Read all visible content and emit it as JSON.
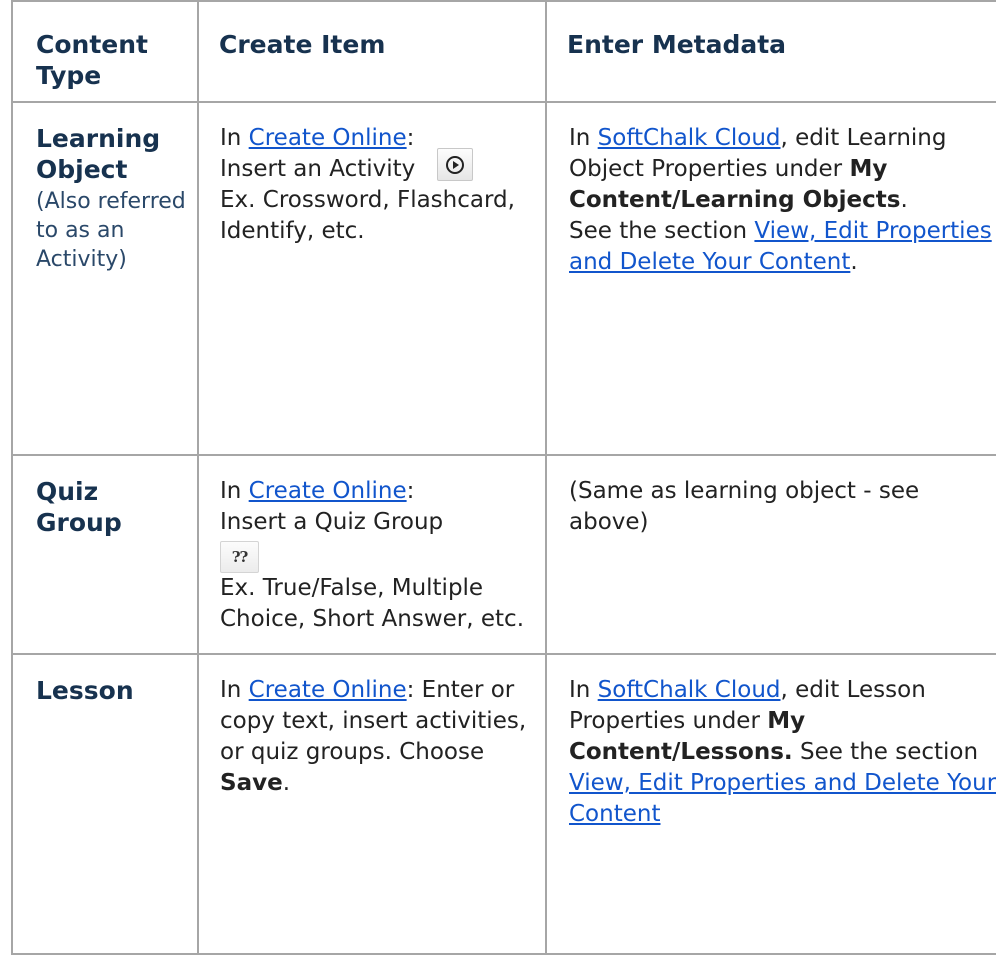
{
  "table": {
    "headers": {
      "col1": "Content Type",
      "col2": "Create Item",
      "col3": "Enter Metadata"
    },
    "rows": {
      "learning_object": {
        "type": "Learning Object",
        "note": "(Also referred to as an Activity)",
        "create": {
          "intro_prefix": "In ",
          "intro_link": "Create Online",
          "intro_suffix": ":",
          "step": "Insert an Activity",
          "icon": "play-circle-icon",
          "example": "Ex. Crossword, Flashcard, Identify, etc."
        },
        "metadata": {
          "p1_prefix": "In ",
          "p1_link": "SoftChalk Cloud",
          "p1_mid": ", edit Learning Object Properties under ",
          "p1_bold": "My Content/Learning Objects",
          "p1_suffix": ".",
          "p2_prefix": "See the section ",
          "p2_link": "View, Edit Properties and Delete Your Content",
          "p2_suffix": "."
        }
      },
      "quiz_group": {
        "type": "Quiz Group",
        "create": {
          "intro_prefix": "In ",
          "intro_link": "Create Online",
          "intro_suffix": ":",
          "step": "Insert a Quiz Group",
          "icon_text": "??",
          "example": "Ex. True/False, Multiple Choice, Short Answer, etc."
        },
        "metadata": {
          "text": "(Same as learning object - see above)"
        }
      },
      "lesson": {
        "type": "Lesson",
        "create": {
          "intro_prefix": "In ",
          "intro_link": "Create Online",
          "intro_suffix": ":",
          "body": " Enter or copy text, insert activities, or quiz groups. Choose ",
          "body_bold": "Save",
          "body_suffix": "."
        },
        "metadata": {
          "p1_prefix": "In ",
          "p1_link": "SoftChalk Cloud",
          "p1_mid": ", edit Lesson Properties under ",
          "p1_bold": "My Content/Lessons.",
          "p1_mid2": " See the section ",
          "p1_link2": "View, Edit Properties and Delete Your Content"
        }
      }
    }
  },
  "colors": {
    "heading": "#17324f",
    "link": "#1155cc",
    "border": "#a6a6a6"
  }
}
